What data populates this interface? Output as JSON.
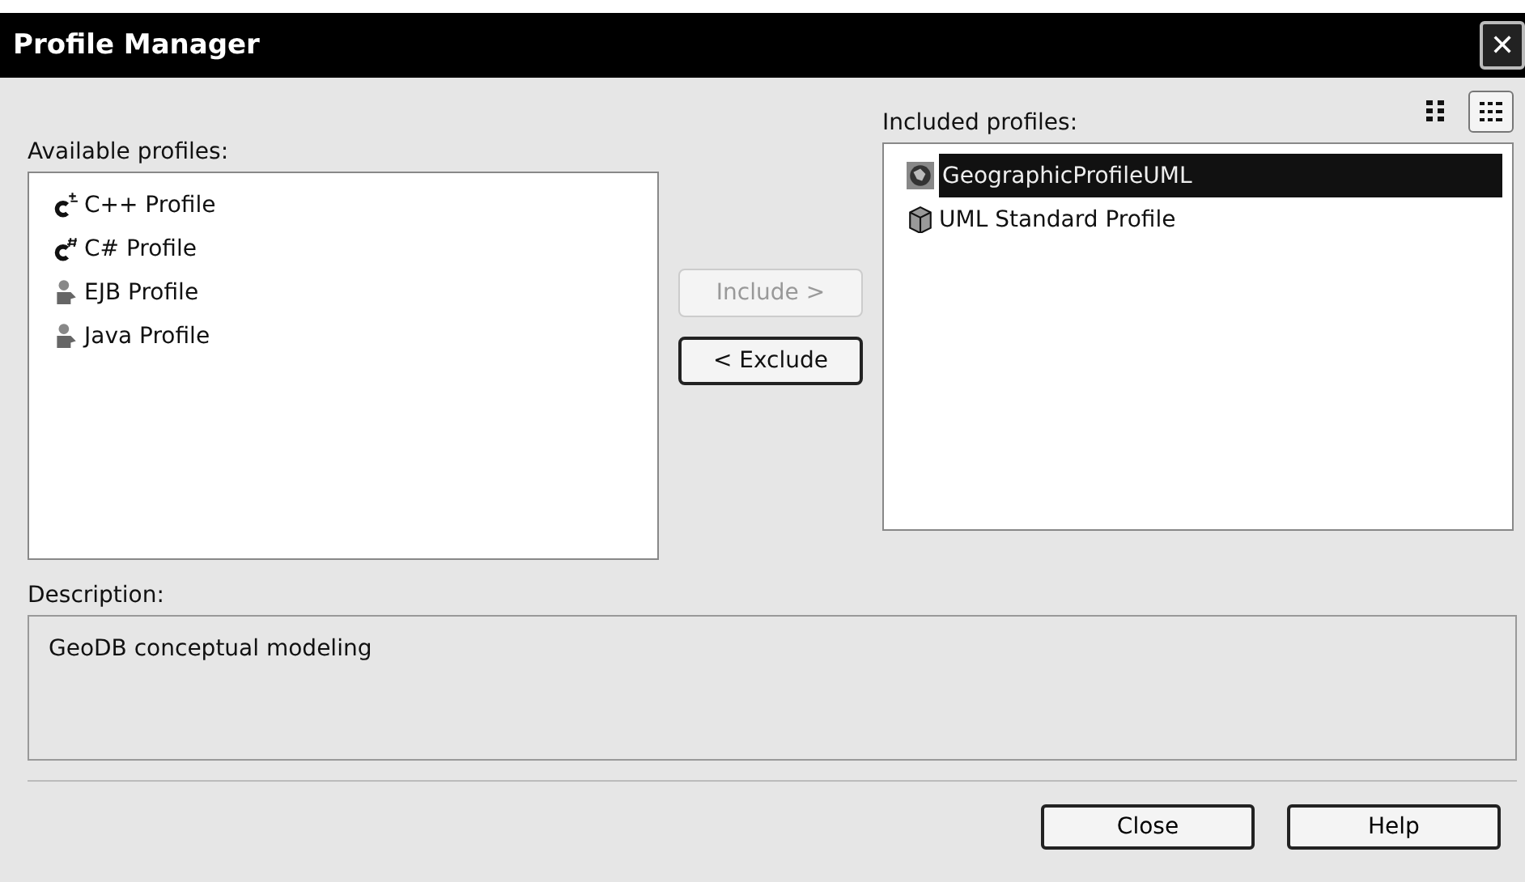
{
  "window": {
    "title": "Profile Manager",
    "close": "✕"
  },
  "view_buttons": [
    {
      "kind": "columns",
      "selected": false
    },
    {
      "kind": "details",
      "selected": true
    }
  ],
  "available": {
    "label": "Available profiles:",
    "items": [
      {
        "label": "C++ Profile",
        "kind": "lang-plus",
        "selected": false
      },
      {
        "label": "C# Profile",
        "kind": "lang-sharp",
        "selected": false
      },
      {
        "label": "EJB Profile",
        "kind": "figure",
        "selected": false
      },
      {
        "label": "Java Profile",
        "kind": "figure",
        "selected": false
      }
    ]
  },
  "actions": [
    {
      "label": "Include >",
      "disabled": true
    },
    {
      "label": "< Exclude",
      "disabled": false
    }
  ],
  "included": {
    "label": "Included profiles:",
    "items": [
      {
        "label": "GeographicProfileUML",
        "kind": "globe",
        "selected": true
      },
      {
        "label": "UML Standard Profile",
        "kind": "package",
        "selected": false
      }
    ]
  },
  "description": {
    "label": "Description:",
    "text": "GeoDB conceptual modeling"
  },
  "buttons": [
    "Close",
    "Help"
  ]
}
